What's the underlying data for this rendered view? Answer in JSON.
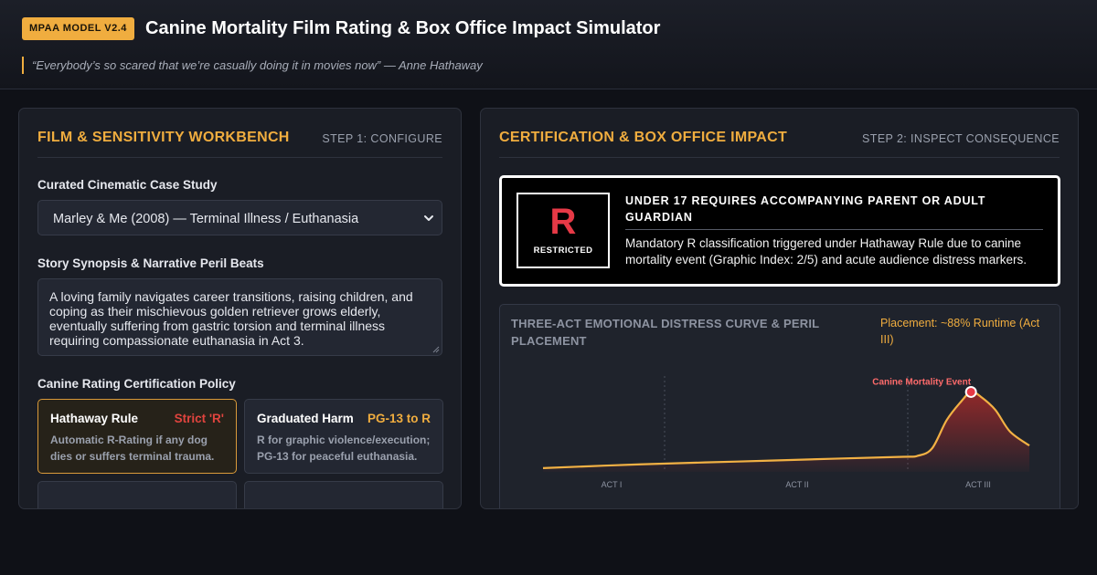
{
  "header": {
    "badge": "MPAA MODEL V2.4",
    "title": "Canine Mortality Film Rating & Box Office Impact Simulator",
    "quote": "“Everybody’s so scared that we’re casually doing it in movies now” — Anne Hathaway"
  },
  "left_panel": {
    "title": "FILM & SENSITIVITY WORKBENCH",
    "step": "STEP 1: CONFIGURE",
    "case_study_label": "Curated Cinematic Case Study",
    "case_study_value": "Marley & Me (2008) — Terminal Illness / Euthanasia",
    "synopsis_label": "Story Synopsis & Narrative Peril Beats",
    "synopsis_text": "A loving family navigates career transitions, raising children, and coping as their mischievous golden retriever grows elderly, eventually suffering from gastric torsion and terminal illness requiring compassionate euthanasia in Act 3.",
    "policy_label": "Canine Rating Certification Policy",
    "policies": [
      {
        "name": "Hathaway Rule",
        "tag": "Strict 'R'",
        "tag_color": "#e0443e",
        "desc": "Automatic R-Rating if any dog dies or suffers terminal trauma.",
        "active": true
      },
      {
        "name": "Graduated Harm",
        "tag": "PG-13 to R",
        "tag_color": "#f0ad3f",
        "desc": "R for graphic violence/execution; PG-13 for peaceful euthanasia.",
        "active": false
      },
      {
        "name": "",
        "tag": "",
        "tag_color": "#f0ad3f",
        "desc": "",
        "active": false
      },
      {
        "name": "",
        "tag": "",
        "tag_color": "#f0ad3f",
        "desc": "",
        "active": false
      }
    ]
  },
  "right_panel": {
    "title": "CERTIFICATION & BOX OFFICE IMPACT",
    "step": "STEP 2: INSPECT CONSEQUENCE",
    "rating_letter": "R",
    "rating_word": "RESTRICTED",
    "cert_heading": "UNDER 17 REQUIRES ACCOMPANYING PARENT OR ADULT GUARDIAN",
    "cert_body": "Mandatory R classification triggered under Hathaway Rule due to canine mortality event (Graphic Index: 2/5) and acute audience distress markers.",
    "curve_title": "THREE-ACT EMOTIONAL DISTRESS CURVE & PERIL PLACEMENT",
    "placement": "Placement: ~88% Runtime (Act III)"
  },
  "chart_data": {
    "type": "area",
    "title": "THREE-ACT EMOTIONAL DISTRESS CURVE & PERIL PLACEMENT",
    "x": [
      0,
      0.2,
      0.4,
      0.6,
      0.74,
      0.77,
      0.8,
      0.83,
      0.86,
      0.88,
      0.9,
      0.93,
      0.96,
      1.0
    ],
    "y": [
      4,
      8,
      11,
      14,
      16,
      17,
      25,
      55,
      75,
      85,
      80,
      66,
      43,
      28
    ],
    "ylim": [
      0,
      100
    ],
    "xlim": [
      0,
      1
    ],
    "act_labels": [
      "ACT I",
      "ACT II",
      "ACT III"
    ],
    "act_boundaries": [
      0.25,
      0.75
    ],
    "peak_x": 0.88,
    "peak_y": 85,
    "annotation": "Canine Mortality Event",
    "line_color": "#f2b144",
    "marker_color": "#e63946",
    "grid": false
  }
}
